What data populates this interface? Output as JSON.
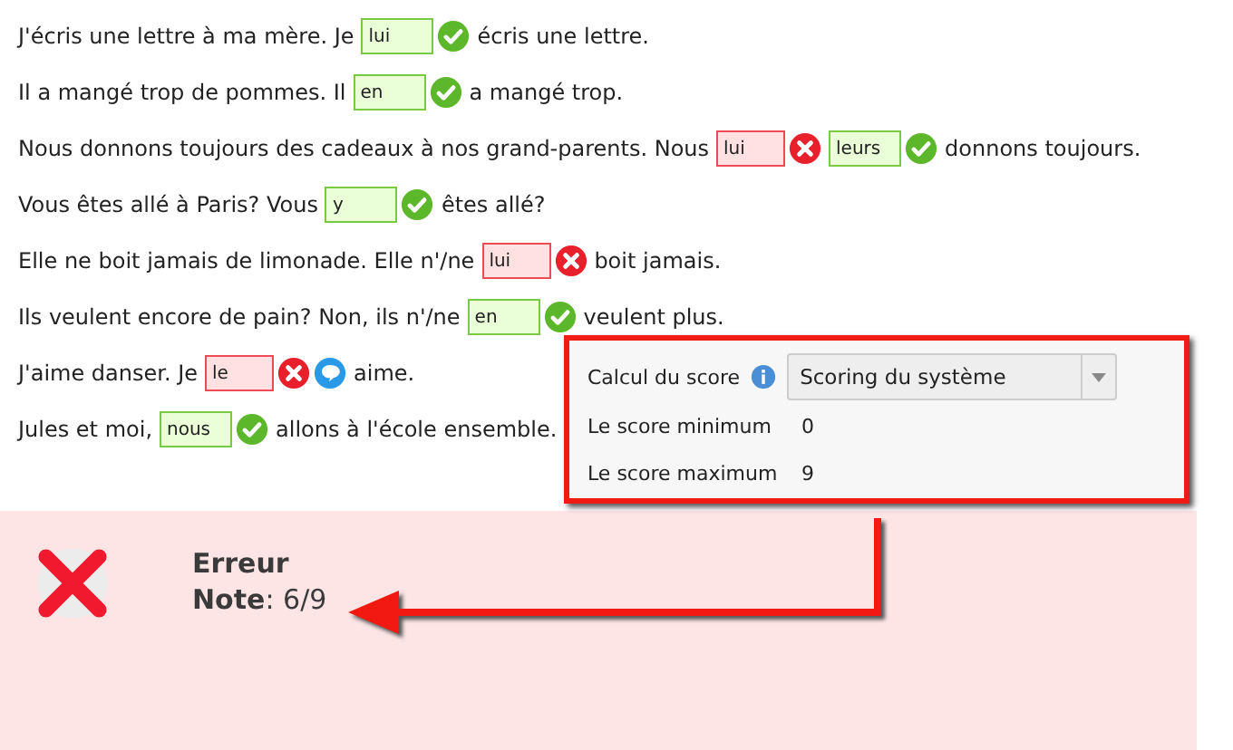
{
  "sentences": [
    [
      {
        "kind": "text",
        "text": "J'écris une lettre à ma mère. Je"
      },
      {
        "kind": "blank",
        "value": "lui",
        "correct": true,
        "feedback": false
      },
      {
        "kind": "text",
        "text": "écris une lettre."
      }
    ],
    [
      {
        "kind": "text",
        "text": "Il a mangé trop de pommes. Il"
      },
      {
        "kind": "blank",
        "value": "en",
        "correct": true,
        "feedback": false
      },
      {
        "kind": "text",
        "text": "a mangé trop."
      }
    ],
    [
      {
        "kind": "text",
        "text": "Nous donnons toujours des cadeaux à nos grand-parents. Nous"
      },
      {
        "kind": "blank",
        "value": "lui",
        "correct": false,
        "feedback": false
      },
      {
        "kind": "blank",
        "value": "leurs",
        "correct": true,
        "feedback": false
      },
      {
        "kind": "text",
        "text": "donnons toujours."
      }
    ],
    [
      {
        "kind": "text",
        "text": "Vous êtes allé à Paris? Vous"
      },
      {
        "kind": "blank",
        "value": "y",
        "correct": true,
        "feedback": false
      },
      {
        "kind": "text",
        "text": "êtes allé?"
      }
    ],
    [
      {
        "kind": "text",
        "text": "Elle ne boit jamais de limonade. Elle n'/ne"
      },
      {
        "kind": "blank",
        "value": "lui",
        "correct": false,
        "feedback": false
      },
      {
        "kind": "text",
        "text": "boit jamais."
      }
    ],
    [
      {
        "kind": "text",
        "text": "Ils veulent encore de pain? Non, ils n'/ne"
      },
      {
        "kind": "blank",
        "value": "en",
        "correct": true,
        "feedback": false
      },
      {
        "kind": "text",
        "text": "veulent plus."
      }
    ],
    [
      {
        "kind": "text",
        "text": "J'aime danser. Je"
      },
      {
        "kind": "blank",
        "value": "le",
        "correct": false,
        "feedback": true
      },
      {
        "kind": "text",
        "text": "aime."
      }
    ],
    [
      {
        "kind": "text",
        "text": "Jules et moi,"
      },
      {
        "kind": "blank",
        "value": "nous",
        "correct": true,
        "feedback": false
      },
      {
        "kind": "text",
        "text": "allons à l'école ensemble."
      }
    ]
  ],
  "score_panel": {
    "method_label": "Calcul du score",
    "method_value": "Scoring du système",
    "rows": [
      {
        "label": "Le score minimum",
        "value": "0"
      },
      {
        "label": "Le score maximum",
        "value": "9"
      }
    ]
  },
  "result": {
    "correct": false,
    "title": "Erreur",
    "note": "**Note**: 6/9"
  }
}
